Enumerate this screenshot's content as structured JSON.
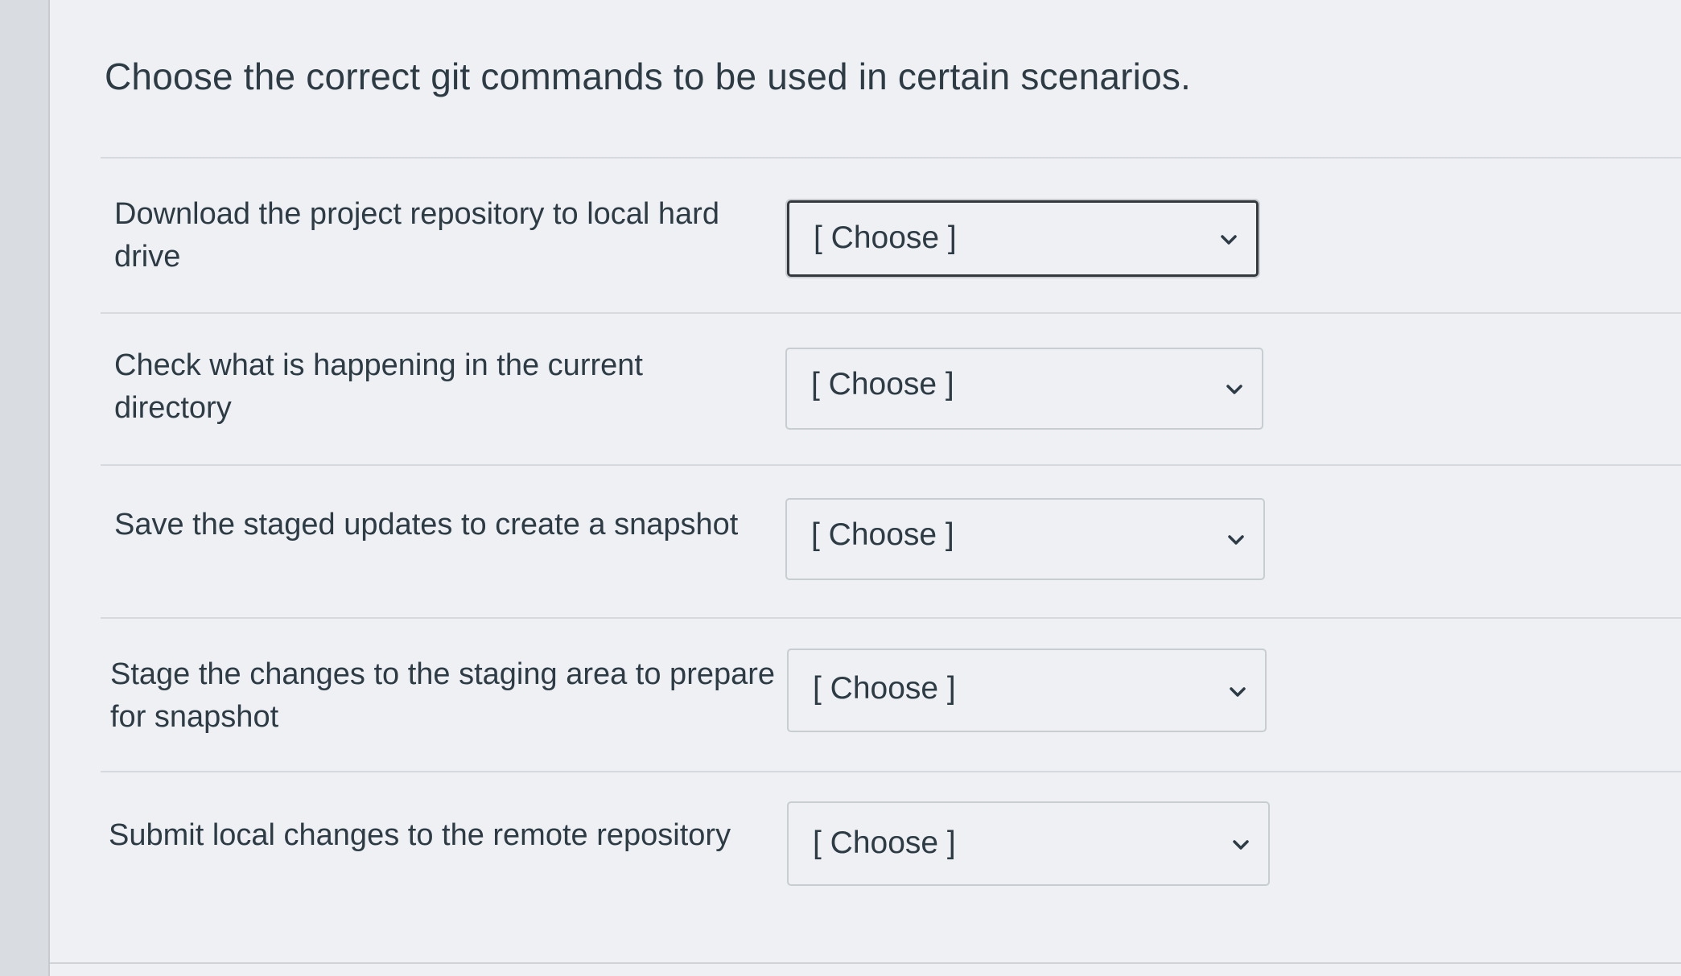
{
  "question": {
    "text": "Choose the correct git commands to be used in certain scenarios."
  },
  "rows": [
    {
      "label": "Download the project repository to local hard drive",
      "selected": "[ Choose ]"
    },
    {
      "label": "Check what is happening in the current directory",
      "selected": "[ Choose ]"
    },
    {
      "label": "Save the staged updates to create a snapshot",
      "selected": "[ Choose ]"
    },
    {
      "label": "Stage the changes to the staging area to prepare for snapshot",
      "selected": "[ Choose ]"
    },
    {
      "label": "Submit local changes to the remote repository",
      "selected": "[ Choose ]"
    }
  ],
  "icons": {
    "dropdown": "chevron-down-icon"
  },
  "colors": {
    "text": "#2d3b45",
    "focus_border": "#33393d",
    "border": "#c7cdd1",
    "background": "#eef0f3"
  }
}
